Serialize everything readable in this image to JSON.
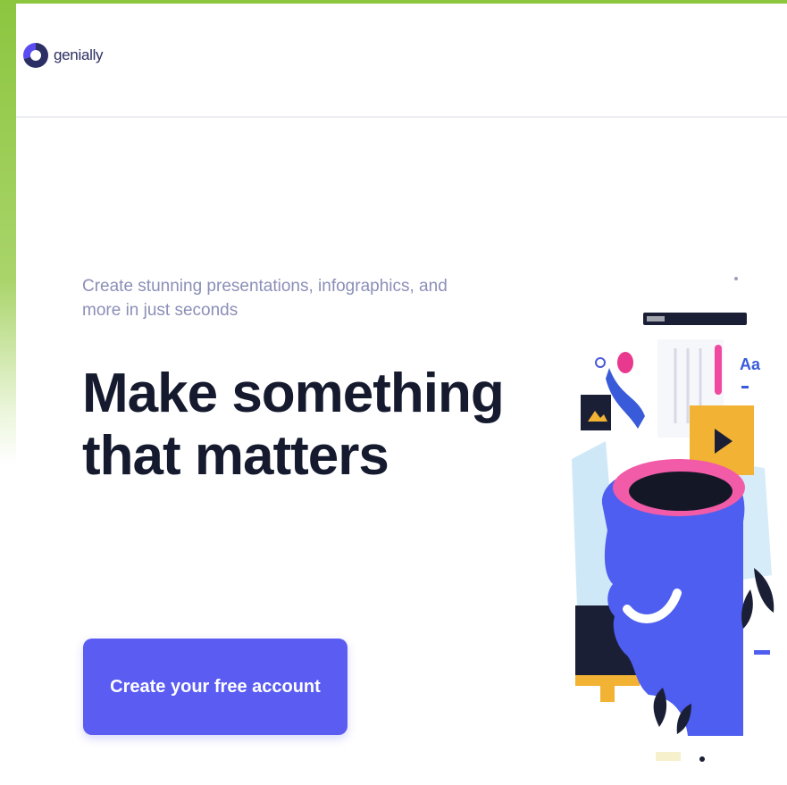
{
  "brand": {
    "name": "genially",
    "logo_icon": "genially-logo-icon"
  },
  "hero": {
    "subtitle": "Create stunning presentations, infographics, and more in just seconds",
    "headline": "Make something that matters",
    "cta_label": "Create your free account"
  },
  "illustration": {
    "aa_text": "Aa",
    "icons": [
      "play-icon",
      "image-icon",
      "leaf-icon"
    ]
  },
  "colors": {
    "frame": "#8cc63f",
    "accent": "#5a5cf2",
    "headline": "#151a2e",
    "subtitle": "#8b8fb8",
    "pink": "#f04aa0",
    "yellow": "#f2b233"
  }
}
